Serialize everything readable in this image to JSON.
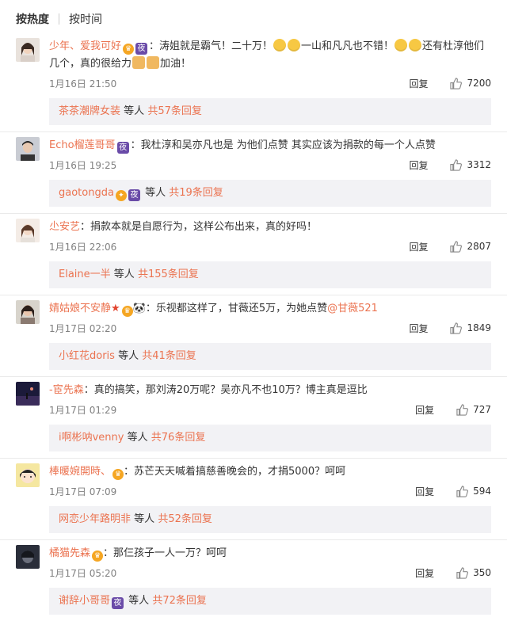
{
  "tabs": {
    "hot": "按热度",
    "time": "按时间"
  },
  "colors": {
    "username": "#eb7350",
    "badge": "#6a4ba8",
    "reply_bg": "#f2f2f5"
  },
  "labels": {
    "reply": "回复",
    "etc": "等人"
  },
  "comments": [
    {
      "user": "少年、爱我可好",
      "text_a": "：涛姐就是霸气！二十万！",
      "text_b": "一山和凡凡也不错！",
      "text_c": "还有杜淳他们几个，真的很给力",
      "text_d": "加油！",
      "time": "1月16日 21:50",
      "likes": "7200",
      "reply_user": "茶茶潮牌女装",
      "reply_count": "共57条回复"
    },
    {
      "user": "Echo榴莲哥哥",
      "text": "：我杜淳和吴亦凡也是 为他们点赞 其实应该为捐款的每一个人点赞",
      "time": "1月16日 19:25",
      "likes": "3312",
      "reply_user": "gaotongda",
      "reply_count": "共19条回复"
    },
    {
      "user": "尐安艺",
      "text": "：捐款本就是自愿行为，这样公布出来，真的好吗！",
      "time": "1月16日 22:06",
      "likes": "2807",
      "reply_user": "Elaine一半",
      "reply_count": "共155条回复"
    },
    {
      "user": "婧姑娘不安静",
      "text": "：乐视都这样了，甘薇还5万，为她点赞",
      "mention": "@甘薇521",
      "time": "1月17日 02:20",
      "likes": "1849",
      "reply_user": "小红花doris",
      "reply_count": "共41条回复"
    },
    {
      "user": "-宦先森",
      "text": "：真的搞笑，那刘涛20万呢？吴亦凡不也10万？博主真是逗比",
      "time": "1月17日 01:29",
      "likes": "727",
      "reply_user": "i啊彬呐venny",
      "reply_count": "共76条回复"
    },
    {
      "user": "棒暖婉開時、",
      "text": "：苏芒天天喊着搞慈善晚会的，才捐5000？呵呵",
      "time": "1月17日 07:09",
      "likes": "594",
      "reply_user": "网恋少年路明非",
      "reply_count": "共52条回复"
    },
    {
      "user": "橘猫先森",
      "text": "：那仨孩子一人一万？呵呵",
      "time": "1月17日 05:20",
      "likes": "350",
      "reply_user": "谢辞小哥哥",
      "reply_count": "共72条回复"
    }
  ]
}
